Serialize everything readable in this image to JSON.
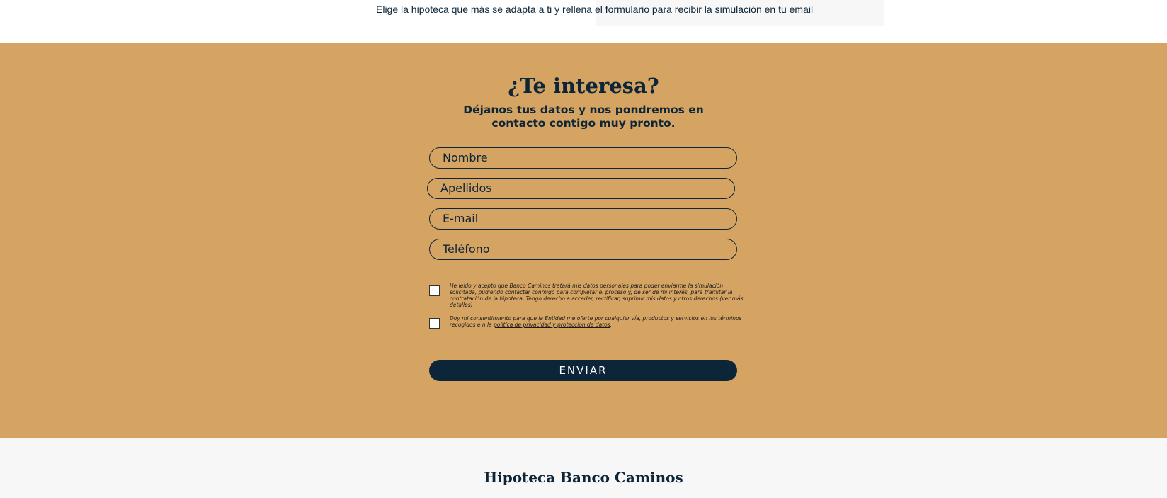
{
  "intro_text": "Elige la hipoteca que más se adapta a ti y rellena el formulario para recibir la simulación en tu email",
  "form": {
    "title": "¿Te interesa?",
    "subtitle": "Déjanos tus datos y nos pondremos en contacto contigo muy pronto.",
    "fields": {
      "nombre": "Nombre",
      "apellidos": "Apellidos",
      "email": "E-mail",
      "telefono": "Teléfono"
    },
    "consent_1": "He leído y acepto que Banco Caminos tratará mis datos personales para poder enviarme la simulación solicitada, pudiendo contactar conmigo para completar el proceso y, de ser de mi interés, para tramitar la contratación de la hipoteca. Tengo derecho a acceder, rectificar, suprimir mis datos y otros derechos (ver más detalles)",
    "consent_2_text": "Doy mi consentimiento para que la Entidad me oferte por cualquier vía, productos y servicios en los términos recogidos e n la ",
    "consent_2_link": "política de privacidad y protección de datos",
    "consent_2_end": ".",
    "submit_label": "ENVIAR"
  },
  "footer": {
    "title": "Hipoteca Banco Caminos"
  },
  "colors": {
    "band": "#d5a462",
    "navy": "#0c2539",
    "footer_bg": "#f7f7f7"
  }
}
